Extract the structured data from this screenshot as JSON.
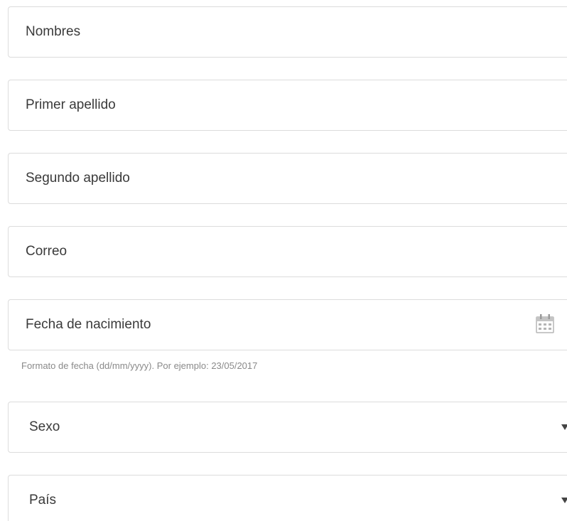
{
  "form": {
    "nombres_placeholder": "Nombres",
    "primer_apellido_placeholder": "Primer apellido",
    "segundo_apellido_placeholder": "Segundo apellido",
    "correo_placeholder": "Correo",
    "fecha_placeholder": "Fecha de nacimiento",
    "fecha_help": "Formato de fecha (dd/mm/yyyy). Por ejemplo: 23/05/2017",
    "sexo_selected": "Sexo",
    "pais_selected": "País"
  },
  "icons": {
    "date_picker": "calendar-icon",
    "select_arrow": "chevron-down-icon"
  },
  "colors": {
    "border": "#dcdcdc",
    "text": "#3a3a3a",
    "help_text": "#8a8a8a",
    "icon": "#b5b5b5"
  }
}
